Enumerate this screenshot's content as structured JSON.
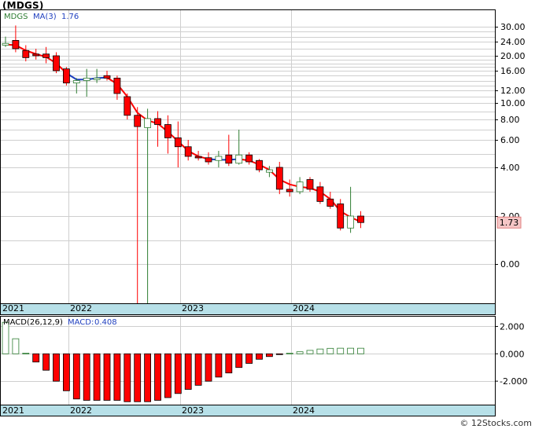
{
  "title": "(MDGS)",
  "credit": "© 12Stocks.com",
  "colors": {
    "up": "#2e7d32",
    "down": "#ff0000",
    "ma_up": "#1f3fbf",
    "ma_down": "#ff0000",
    "macd_up": "#2e7d32",
    "macd_down": "#ff0000",
    "timeline_bg": "#b7e0e8",
    "price_badge_bg": "#f5c6c6"
  },
  "chart_data": [
    {
      "type": "candlestick",
      "legend": {
        "symbol": "MDGS",
        "ma_label": "MA(3)",
        "ma_value": "1.76"
      },
      "last_price_label": "1.73",
      "last_price": 1.73,
      "y_ticks": [
        "30.00",
        "24.00",
        "20.00",
        "16.00",
        "12.00",
        "10.00",
        "8.00",
        "6.00",
        "4.00",
        "2.00",
        "0.00"
      ],
      "x_labels": [
        "2021",
        "2022",
        "2023",
        "2024"
      ],
      "grid": true,
      "candles": [
        {
          "date": "2021-01",
          "o": 23.0,
          "h": 26.0,
          "l": 22.5,
          "c": 23.5
        },
        {
          "date": "2021-02",
          "o": 24.5,
          "h": 30.5,
          "l": 21.0,
          "c": 22.0
        },
        {
          "date": "2021-03",
          "o": 21.5,
          "h": 23.0,
          "l": 18.5,
          "c": 19.5
        },
        {
          "date": "2021-04",
          "o": 20.5,
          "h": 22.0,
          "l": 19.0,
          "c": 20.0
        },
        {
          "date": "2021-05",
          "o": 20.5,
          "h": 22.5,
          "l": 18.0,
          "c": 19.5
        },
        {
          "date": "2021-06",
          "o": 20.0,
          "h": 21.0,
          "l": 15.5,
          "c": 16.0
        },
        {
          "date": "2021-07",
          "o": 16.5,
          "h": 17.0,
          "l": 13.0,
          "c": 13.5
        },
        {
          "date": "2021-08",
          "o": 13.5,
          "h": 14.5,
          "l": 11.5,
          "c": 14.0
        },
        {
          "date": "2021-09",
          "o": 14.0,
          "h": 16.5,
          "l": 11.0,
          "c": 14.5
        },
        {
          "date": "2021-10",
          "o": 14.5,
          "h": 16.5,
          "l": 13.5,
          "c": 14.5
        },
        {
          "date": "2021-11",
          "o": 15.0,
          "h": 16.0,
          "l": 14.0,
          "c": 14.5
        },
        {
          "date": "2021-12",
          "o": 14.5,
          "h": 15.0,
          "l": 10.5,
          "c": 11.5
        },
        {
          "date": "2022-01",
          "o": 11.0,
          "h": 11.5,
          "l": 8.0,
          "c": 8.5
        },
        {
          "date": "2022-02",
          "o": 8.5,
          "h": 9.5,
          "l": -2.0,
          "c": 7.3
        },
        {
          "date": "2022-03",
          "o": 7.2,
          "h": 9.3,
          "l": -3.5,
          "c": 8.1
        },
        {
          "date": "2022-04",
          "o": 8.1,
          "h": 9.0,
          "l": 5.5,
          "c": 7.5
        },
        {
          "date": "2022-05",
          "o": 7.5,
          "h": 8.5,
          "l": 5.0,
          "c": 6.2
        },
        {
          "date": "2022-06",
          "o": 6.2,
          "h": 7.8,
          "l": 4.0,
          "c": 5.5
        },
        {
          "date": "2022-07",
          "o": 5.5,
          "h": 6.0,
          "l": 4.5,
          "c": 4.8
        },
        {
          "date": "2022-08",
          "o": 4.8,
          "h": 5.2,
          "l": 4.5,
          "c": 4.7
        },
        {
          "date": "2022-09",
          "o": 4.7,
          "h": 5.1,
          "l": 4.2,
          "c": 4.4
        },
        {
          "date": "2022-10",
          "o": 4.5,
          "h": 5.2,
          "l": 4.0,
          "c": 4.8
        },
        {
          "date": "2022-11",
          "o": 4.9,
          "h": 6.5,
          "l": 4.1,
          "c": 4.3
        },
        {
          "date": "2022-12",
          "o": 4.3,
          "h": 7.0,
          "l": 4.2,
          "c": 4.9
        },
        {
          "date": "2023-01",
          "o": 4.9,
          "h": 5.1,
          "l": 4.2,
          "c": 4.4
        },
        {
          "date": "2023-02",
          "o": 4.5,
          "h": 4.6,
          "l": 3.8,
          "c": 3.9
        },
        {
          "date": "2023-03",
          "o": 3.8,
          "h": 4.1,
          "l": 3.6,
          "c": 3.9
        },
        {
          "date": "2023-04",
          "o": 4.0,
          "h": 4.4,
          "l": 2.9,
          "c": 3.1
        },
        {
          "date": "2023-05",
          "o": 3.1,
          "h": 3.5,
          "l": 2.8,
          "c": 3.0
        },
        {
          "date": "2023-06",
          "o": 3.0,
          "h": 3.6,
          "l": 2.9,
          "c": 3.4
        },
        {
          "date": "2023-07",
          "o": 3.5,
          "h": 3.6,
          "l": 3.0,
          "c": 3.1
        },
        {
          "date": "2023-08",
          "o": 3.2,
          "h": 3.4,
          "l": 2.5,
          "c": 2.6
        },
        {
          "date": "2023-09",
          "o": 2.7,
          "h": 3.0,
          "l": 2.3,
          "c": 2.4
        },
        {
          "date": "2023-10",
          "o": 2.5,
          "h": 2.7,
          "l": 1.4,
          "c": 1.5
        },
        {
          "date": "2023-11",
          "o": 1.5,
          "h": 3.2,
          "l": 1.3,
          "c": 2.0
        },
        {
          "date": "2023-12",
          "o": 2.0,
          "h": 2.2,
          "l": 1.5,
          "c": 1.73
        }
      ],
      "ma": [
        {
          "date": "2021-01",
          "v": 23.2,
          "up": true
        },
        {
          "date": "2021-02",
          "v": 23.0,
          "up": false
        },
        {
          "date": "2021-03",
          "v": 21.5,
          "up": false
        },
        {
          "date": "2021-04",
          "v": 20.5,
          "up": false
        },
        {
          "date": "2021-05",
          "v": 19.7,
          "up": false
        },
        {
          "date": "2021-06",
          "v": 18.0,
          "up": false
        },
        {
          "date": "2021-07",
          "v": 15.5,
          "up": false
        },
        {
          "date": "2021-08",
          "v": 14.2,
          "up": true
        },
        {
          "date": "2021-09",
          "v": 14.2,
          "up": true
        },
        {
          "date": "2021-10",
          "v": 14.5,
          "up": true
        },
        {
          "date": "2021-11",
          "v": 14.6,
          "up": true
        },
        {
          "date": "2021-12",
          "v": 13.3,
          "up": false
        },
        {
          "date": "2022-01",
          "v": 11.0,
          "up": false
        },
        {
          "date": "2022-02",
          "v": 8.8,
          "up": false
        },
        {
          "date": "2022-03",
          "v": 7.9,
          "up": false
        },
        {
          "date": "2022-04",
          "v": 7.6,
          "up": false
        },
        {
          "date": "2022-05",
          "v": 6.8,
          "up": false
        },
        {
          "date": "2022-06",
          "v": 5.9,
          "up": false
        },
        {
          "date": "2022-07",
          "v": 5.2,
          "up": false
        },
        {
          "date": "2022-08",
          "v": 4.8,
          "up": false
        },
        {
          "date": "2022-09",
          "v": 4.6,
          "up": false
        },
        {
          "date": "2022-10",
          "v": 4.55,
          "up": true
        },
        {
          "date": "2022-11",
          "v": 4.55,
          "up": true
        },
        {
          "date": "2022-12",
          "v": 4.6,
          "up": true
        },
        {
          "date": "2023-01",
          "v": 4.5,
          "up": false
        },
        {
          "date": "2023-02",
          "v": 4.2,
          "up": false
        },
        {
          "date": "2023-03",
          "v": 3.9,
          "up": false
        },
        {
          "date": "2023-04",
          "v": 3.5,
          "up": false
        },
        {
          "date": "2023-05",
          "v": 3.3,
          "up": false
        },
        {
          "date": "2023-06",
          "v": 3.2,
          "up": false
        },
        {
          "date": "2023-07",
          "v": 3.15,
          "up": false
        },
        {
          "date": "2023-08",
          "v": 3.0,
          "up": false
        },
        {
          "date": "2023-09",
          "v": 2.7,
          "up": false
        },
        {
          "date": "2023-10",
          "v": 2.2,
          "up": false
        },
        {
          "date": "2023-11",
          "v": 1.95,
          "up": false
        },
        {
          "date": "2023-12",
          "v": 1.76,
          "up": false
        }
      ]
    },
    {
      "type": "bar",
      "legend": {
        "label": "MACD(26,12,9)",
        "name": "MACD",
        "value": "0.408"
      },
      "y_ticks": [
        "2.000",
        "0.000",
        "-2.000"
      ],
      "ylim": [
        -3.6,
        2.6
      ],
      "x_labels": [
        "2021",
        "2022",
        "2023",
        "2024"
      ],
      "values": [
        2.3,
        1.1,
        0.05,
        -0.6,
        -1.2,
        -2.0,
        -2.7,
        -3.3,
        -3.4,
        -3.4,
        -3.4,
        -3.4,
        -3.5,
        -3.5,
        -3.5,
        -3.4,
        -3.2,
        -2.9,
        -2.6,
        -2.3,
        -2.0,
        -1.7,
        -1.4,
        -1.0,
        -0.7,
        -0.4,
        -0.2,
        -0.05,
        0.05,
        0.15,
        0.25,
        0.35,
        0.4,
        0.41,
        0.41,
        0.408
      ]
    }
  ]
}
